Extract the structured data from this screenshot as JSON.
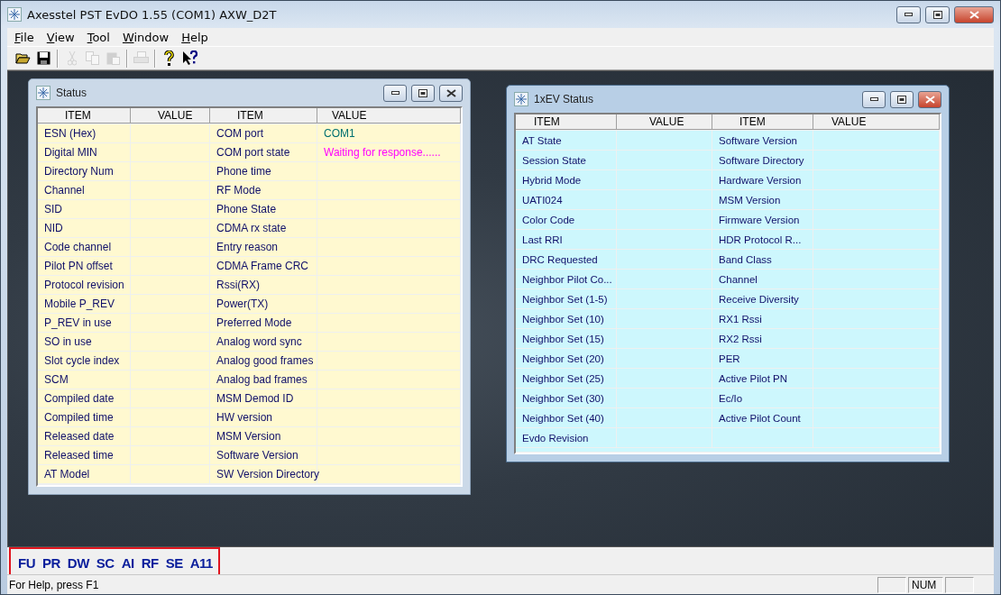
{
  "window": {
    "title": "Axesstel PST EvDO 1.55 (COM1) AXW_D2T"
  },
  "menu": [
    "File",
    "View",
    "Tool",
    "Window",
    "Help"
  ],
  "toolbar": [
    {
      "kind": "open",
      "disabled": false
    },
    {
      "kind": "save",
      "disabled": false
    },
    {
      "kind": "separator"
    },
    {
      "kind": "cut",
      "disabled": true
    },
    {
      "kind": "copy",
      "disabled": true
    },
    {
      "kind": "paste",
      "disabled": true
    },
    {
      "kind": "separator"
    },
    {
      "kind": "print",
      "disabled": true
    },
    {
      "kind": "separator"
    },
    {
      "kind": "help",
      "disabled": false
    },
    {
      "kind": "context-help",
      "disabled": false
    }
  ],
  "child_windows": [
    {
      "title": "Status",
      "active": false,
      "columns": [
        "ITEM",
        "VALUE",
        "ITEM",
        "VALUE"
      ],
      "rows": [
        {
          "left_item": "ESN (Hex)",
          "right_item": "COM port",
          "right_value": {
            "text": "COM1",
            "color": "#007070"
          }
        },
        {
          "left_item": "Digital MIN",
          "right_item": "COM port state",
          "right_value": {
            "text": "Waiting for response......",
            "color": "#ff00ff"
          }
        },
        {
          "left_item": "Directory Num",
          "right_item": "Phone time"
        },
        {
          "left_item": "Channel",
          "right_item": "RF Mode"
        },
        {
          "left_item": "SID",
          "right_item": "Phone State"
        },
        {
          "left_item": "NID",
          "right_item": "CDMA rx state"
        },
        {
          "left_item": "Code channel",
          "right_item": "Entry reason"
        },
        {
          "left_item": "Pilot PN offset",
          "right_item": "CDMA Frame CRC"
        },
        {
          "left_item": "Protocol revision",
          "right_item": "Rssi(RX)"
        },
        {
          "left_item": "Mobile P_REV",
          "right_item": "Power(TX)"
        },
        {
          "left_item": "P_REV in use",
          "right_item": "Preferred Mode"
        },
        {
          "left_item": "SO in use",
          "right_item": "Analog word sync"
        },
        {
          "left_item": "Slot cycle index",
          "right_item": "Analog good frames"
        },
        {
          "left_item": "SCM",
          "right_item": "Analog bad frames"
        },
        {
          "left_item": "Compiled date",
          "right_item": "MSM Demod ID"
        },
        {
          "left_item": "Compiled time",
          "right_item": "HW version"
        },
        {
          "left_item": "Released date",
          "right_item": "MSM Version"
        },
        {
          "left_item": "Released time",
          "right_item": "Software Version"
        },
        {
          "left_item": "AT Model",
          "right_item": "SW Version Directory"
        }
      ]
    },
    {
      "title": "1xEV Status",
      "active": true,
      "columns": [
        "ITEM",
        "VALUE",
        "ITEM",
        "VALUE"
      ],
      "rows": [
        {
          "left_item": "AT State",
          "right_item": "Software Version"
        },
        {
          "left_item": "Session State",
          "right_item": "Software Directory"
        },
        {
          "left_item": "Hybrid Mode",
          "right_item": "Hardware Version"
        },
        {
          "left_item": "UATI024",
          "right_item": "MSM Version"
        },
        {
          "left_item": "Color Code",
          "right_item": "Firmware Version"
        },
        {
          "left_item": "Last RRI",
          "right_item": "HDR Protocol R..."
        },
        {
          "left_item": "DRC Requested",
          "right_item": "Band Class"
        },
        {
          "left_item": "Neighbor Pilot Co...",
          "right_item": "Channel"
        },
        {
          "left_item": "Neighbor Set (1-5)",
          "right_item": "Receive Diversity"
        },
        {
          "left_item": "Neighbor Set (10)",
          "right_item": "RX1 Rssi"
        },
        {
          "left_item": "Neighbor Set (15)",
          "right_item": "RX2 Rssi"
        },
        {
          "left_item": "Neighbor Set (20)",
          "right_item": "PER"
        },
        {
          "left_item": "Neighbor Set (25)",
          "right_item": "Active Pilot PN"
        },
        {
          "left_item": "Neighbor Set (30)",
          "right_item": "Ec/Io"
        },
        {
          "left_item": "Neighbor Set (40)",
          "right_item": "Active Pilot Count"
        },
        {
          "left_item": "Evdo Revision"
        }
      ]
    }
  ],
  "mode_bar": {
    "highlighted": true,
    "items": [
      "FU",
      "PR",
      "DW",
      "SC",
      "AI",
      "RF",
      "SE",
      "A11"
    ]
  },
  "status_bar": {
    "message": "For Help, press F1",
    "indicators": [
      {
        "text": "NUM",
        "on": true
      }
    ]
  }
}
